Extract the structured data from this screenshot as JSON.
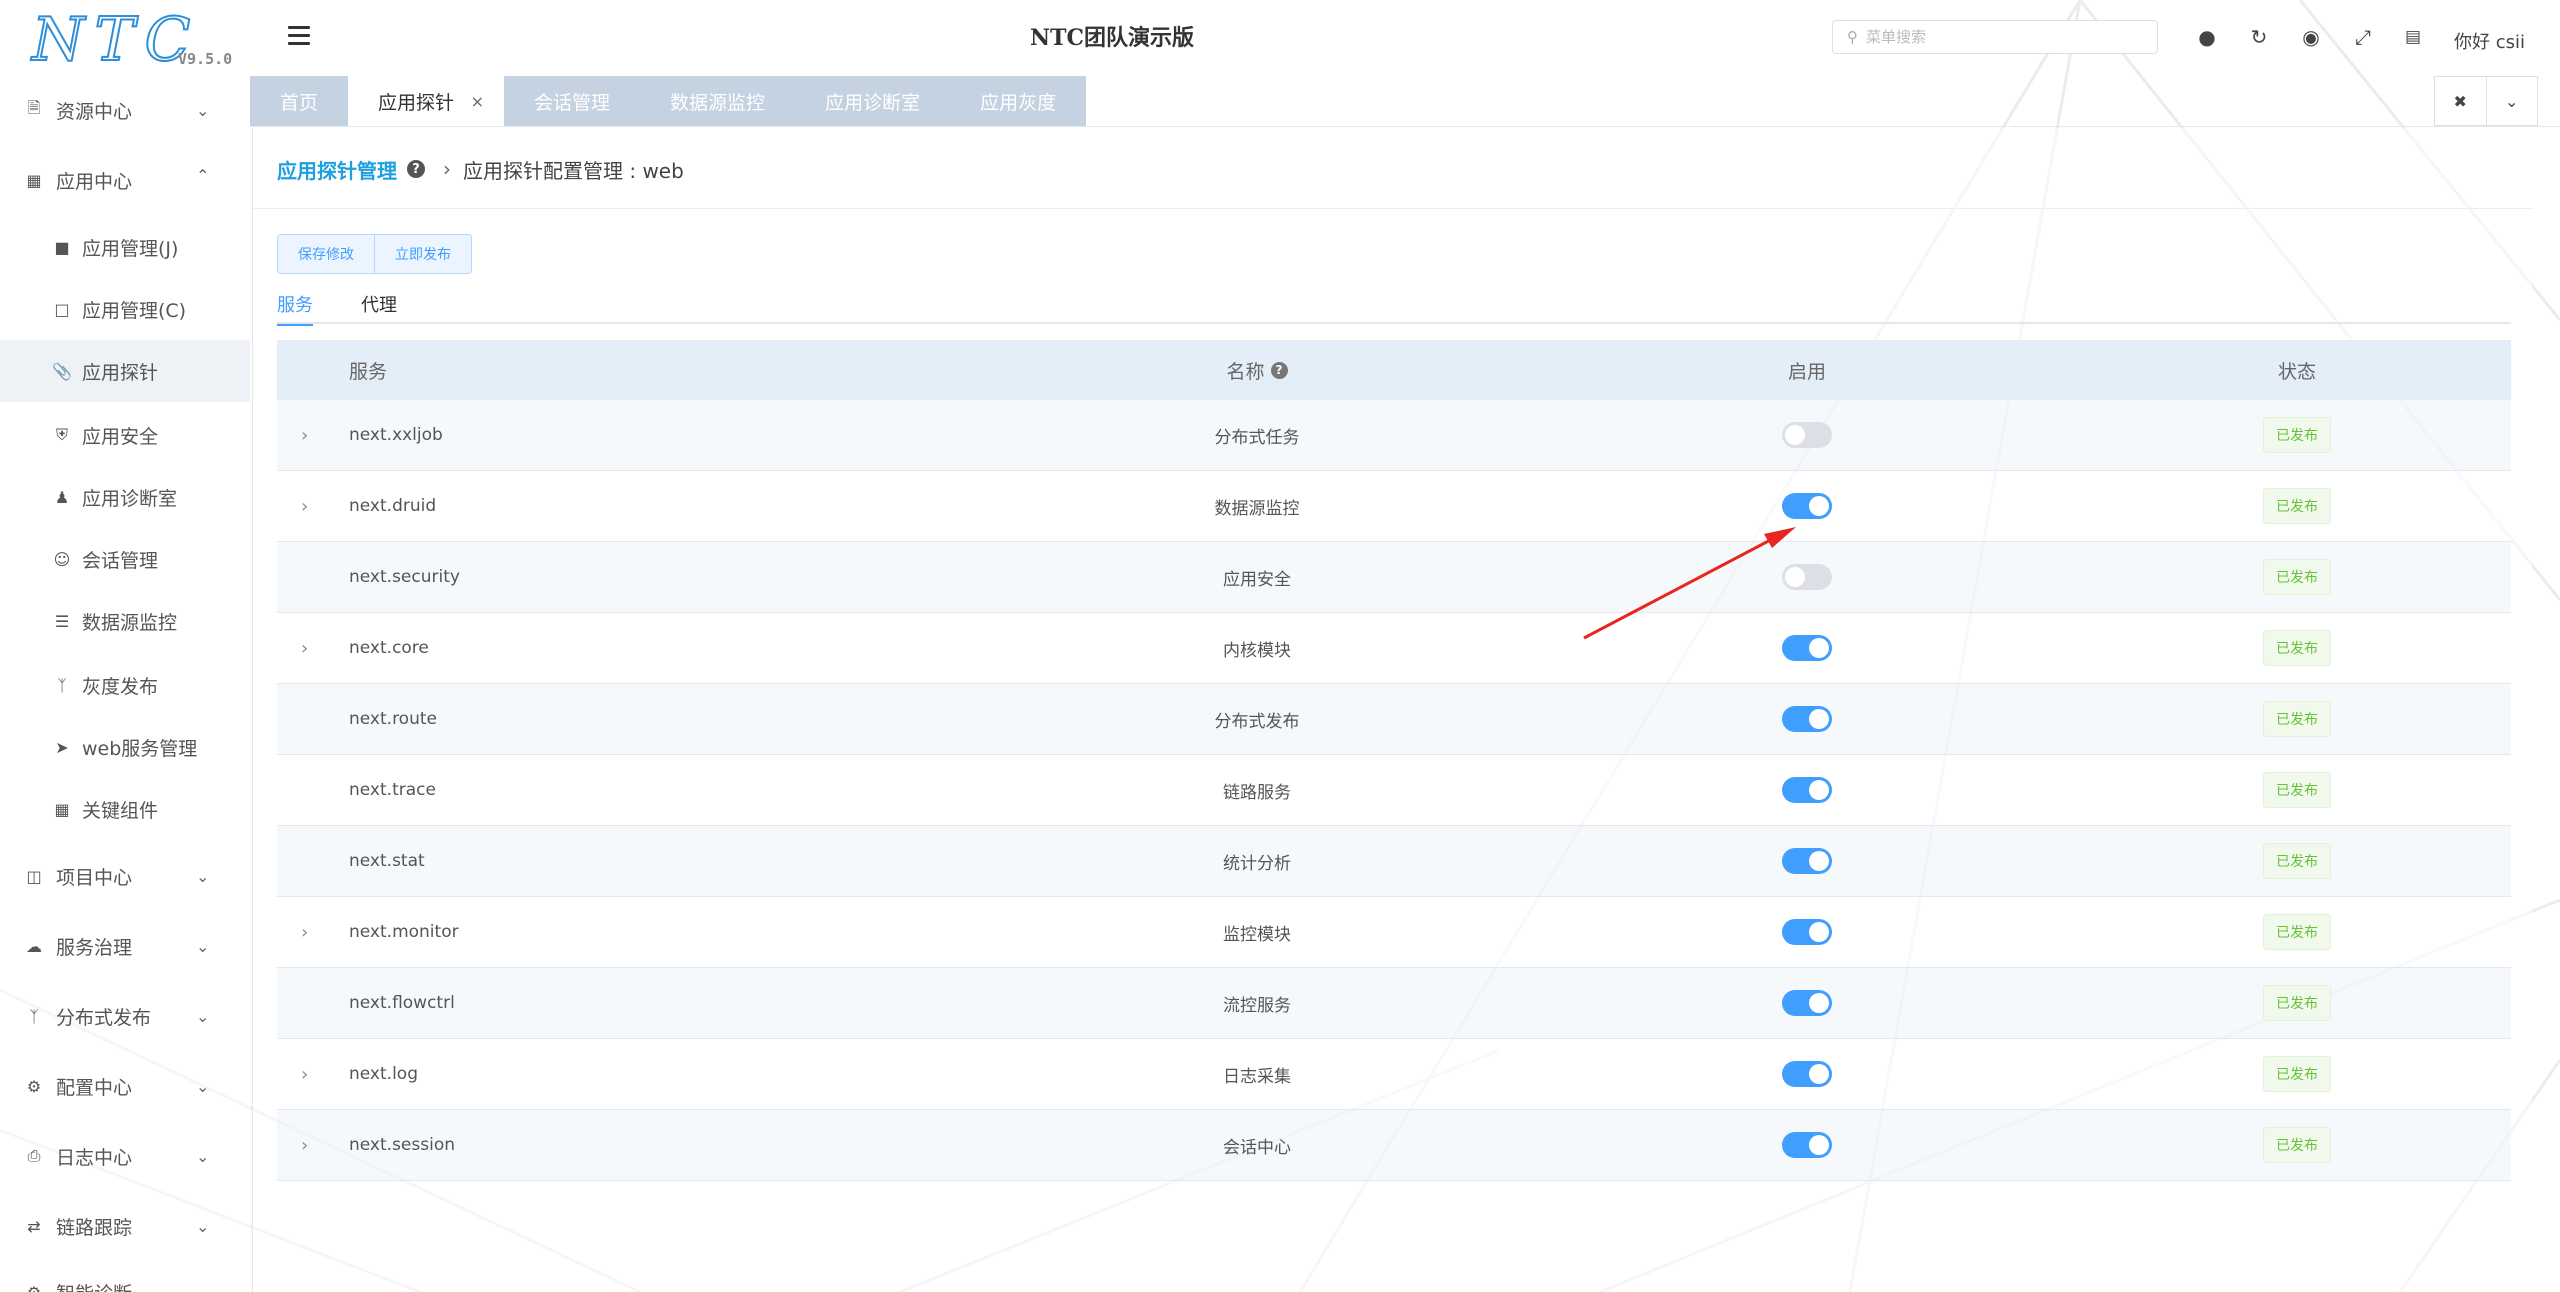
{
  "logo": {
    "text": "NTC",
    "version": "V9.5.0"
  },
  "header": {
    "title": "NTC团队演示版",
    "search_placeholder": "菜单搜索",
    "greeting": "你好 csii",
    "icons": [
      "map-pin-icon",
      "refresh-icon",
      "target-icon",
      "fullscreen-icon",
      "word-doc-icon"
    ]
  },
  "sidebar": {
    "groups_top": [
      {
        "label": "资源中心",
        "icon": "file-icon",
        "expanded": false
      },
      {
        "label": "应用中心",
        "icon": "apps-icon",
        "expanded": true
      }
    ],
    "sub_items": [
      {
        "label": "应用管理(J)",
        "icon": "folder-icon"
      },
      {
        "label": "应用管理(C)",
        "icon": "folder-open-icon"
      },
      {
        "label": "应用探针",
        "icon": "paperclip-icon",
        "active": true
      },
      {
        "label": "应用安全",
        "icon": "shield-icon"
      },
      {
        "label": "应用诊断室",
        "icon": "doctor-icon"
      },
      {
        "label": "会话管理",
        "icon": "user-circle-icon"
      },
      {
        "label": "数据源监控",
        "icon": "database-icon"
      },
      {
        "label": "灰度发布",
        "icon": "branch-icon"
      },
      {
        "label": "web服务管理",
        "icon": "send-icon"
      },
      {
        "label": "关键组件",
        "icon": "grid-icon"
      }
    ],
    "groups_bottom": [
      {
        "label": "项目中心",
        "icon": "project-icon"
      },
      {
        "label": "服务治理",
        "icon": "cloud-icon"
      },
      {
        "label": "分布式发布",
        "icon": "branch-icon"
      },
      {
        "label": "配置中心",
        "icon": "gears-icon"
      },
      {
        "label": "日志中心",
        "icon": "print-icon"
      },
      {
        "label": "链路跟踪",
        "icon": "shuffle-icon"
      },
      {
        "label": "智能诊断",
        "icon": "diagnose-icon"
      }
    ]
  },
  "tabs": [
    {
      "label": "首页",
      "active": false
    },
    {
      "label": "应用探针",
      "active": true,
      "closable": true
    },
    {
      "label": "会话管理",
      "active": false
    },
    {
      "label": "数据源监控",
      "active": false
    },
    {
      "label": "应用诊断室",
      "active": false
    },
    {
      "label": "应用灰度",
      "active": false
    }
  ],
  "breadcrumb": {
    "root": "应用探针管理",
    "current": "应用探针配置管理 : web"
  },
  "buttons": {
    "save": "保存修改",
    "publish": "立即发布"
  },
  "subtabs": [
    "服务",
    "代理"
  ],
  "table": {
    "columns": {
      "service": "服务",
      "name": "名称",
      "enabled": "启用",
      "status": "状态"
    },
    "rows": [
      {
        "service": "next.xxljob",
        "name": "分布式任务",
        "enabled": false,
        "status": "已发布",
        "expandable": true
      },
      {
        "service": "next.druid",
        "name": "数据源监控",
        "enabled": true,
        "status": "已发布",
        "expandable": true
      },
      {
        "service": "next.security",
        "name": "应用安全",
        "enabled": false,
        "status": "已发布",
        "expandable": false
      },
      {
        "service": "next.core",
        "name": "内核模块",
        "enabled": true,
        "status": "已发布",
        "expandable": true
      },
      {
        "service": "next.route",
        "name": "分布式发布",
        "enabled": true,
        "status": "已发布",
        "expandable": false
      },
      {
        "service": "next.trace",
        "name": "链路服务",
        "enabled": true,
        "status": "已发布",
        "expandable": false
      },
      {
        "service": "next.stat",
        "name": "统计分析",
        "enabled": true,
        "status": "已发布",
        "expandable": false
      },
      {
        "service": "next.monitor",
        "name": "监控模块",
        "enabled": true,
        "status": "已发布",
        "expandable": true
      },
      {
        "service": "next.flowctrl",
        "name": "流控服务",
        "enabled": true,
        "status": "已发布",
        "expandable": false
      },
      {
        "service": "next.log",
        "name": "日志采集",
        "enabled": true,
        "status": "已发布",
        "expandable": true
      },
      {
        "service": "next.session",
        "name": "会话中心",
        "enabled": true,
        "status": "已发布",
        "expandable": true
      }
    ]
  },
  "colors": {
    "accent": "#409eff",
    "brand": "#1e9fde",
    "tab_bar": "#c5d2e2",
    "success": "#67c23a",
    "annotation_arrow": "#e8261e"
  }
}
